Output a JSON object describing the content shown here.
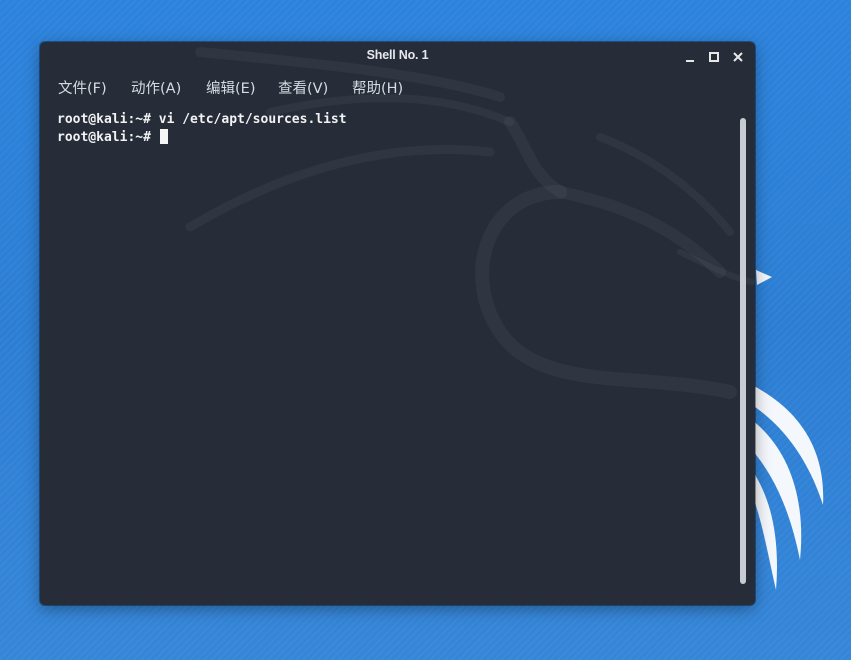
{
  "window": {
    "title": "Shell No. 1"
  },
  "window_controls": [
    {
      "name": "minimize",
      "icon": "minimize-icon"
    },
    {
      "name": "maximize",
      "icon": "maximize-icon"
    },
    {
      "name": "close",
      "icon": "close-icon"
    }
  ],
  "menu": {
    "file": "文件(F)",
    "actions": "动作(A)",
    "edit": "编辑(E)",
    "view": "查看(V)",
    "help": "帮助(H)"
  },
  "terminal": {
    "lines": [
      {
        "prompt": "root@kali:~#",
        "command": " vi /etc/apt/sources.list"
      },
      {
        "prompt": "root@kali:~#",
        "command": " "
      }
    ]
  },
  "colors": {
    "desktop": "#2f7fd3",
    "terminal_bg": "#262d39",
    "terminal_text": "#f2f2f2"
  }
}
